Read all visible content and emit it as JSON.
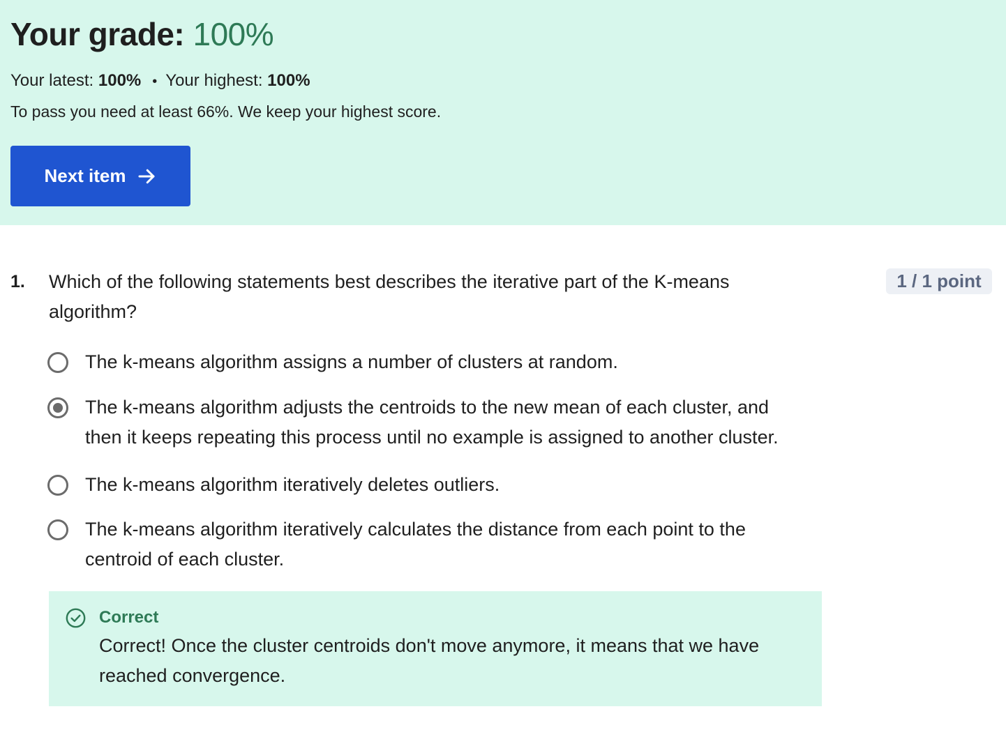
{
  "grade": {
    "title_label": "Your grade:",
    "title_value": "100%",
    "latest_label": "Your latest:",
    "latest_value": "100%",
    "separator": "•",
    "highest_label": "Your highest:",
    "highest_value": "100%",
    "pass_note": "To pass you need at least 66%. We keep your highest score.",
    "next_button_label": "Next item"
  },
  "question": {
    "number": "1.",
    "text": "Which of the following statements best describes the iterative part of the K-means algorithm?",
    "points": "1 / 1 point",
    "options": [
      {
        "text": "The k-means algorithm assigns a number of clusters at random.",
        "selected": false
      },
      {
        "text": "The k-means algorithm adjusts the centroids to the new mean of each cluster, and then it keeps repeating this process until no example is assigned to another cluster.",
        "selected": true
      },
      {
        "text": "The k-means algorithm iteratively deletes outliers.",
        "selected": false
      },
      {
        "text": "The k-means algorithm iteratively calculates the distance from each point to the centroid of each cluster.",
        "selected": false
      }
    ],
    "feedback": {
      "title": "Correct",
      "text": "Correct! Once the cluster centroids don't move anymore, it means that we have reached convergence."
    }
  },
  "colors": {
    "banner_bg": "#d7f7ec",
    "accent_green": "#2e7a56",
    "button_blue": "#1f55d1",
    "badge_bg": "#edf0f5",
    "badge_text": "#5b6780"
  },
  "icons": {
    "next_button": "arrow-right-icon",
    "feedback": "check-circle-icon"
  }
}
